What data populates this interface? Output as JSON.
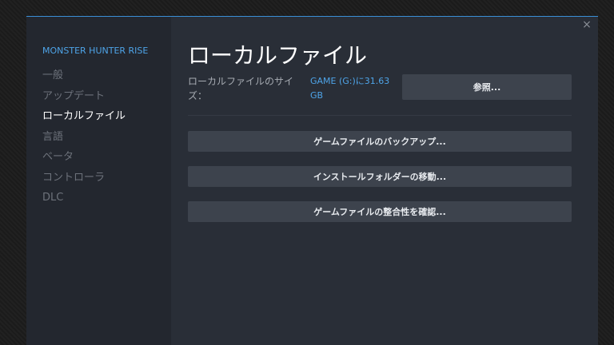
{
  "game_title": "MONSTER HUNTER RISE",
  "close_glyph": "×",
  "nav": [
    {
      "label": "一般",
      "active": false
    },
    {
      "label": "アップデート",
      "active": false
    },
    {
      "label": "ローカルファイル",
      "active": true
    },
    {
      "label": "言語",
      "active": false
    },
    {
      "label": "ベータ",
      "active": false
    },
    {
      "label": "コントローラ",
      "active": false
    },
    {
      "label": "DLC",
      "active": false
    }
  ],
  "main": {
    "title": "ローカルファイル",
    "size_label": "ローカルファイルのサイズ：",
    "size_value": "GAME (G:)に31.63 GB",
    "browse_label": "参照...",
    "backup_label": "ゲームファイルのバックアップ...",
    "move_label": "インストールフォルダーの移動...",
    "verify_label": "ゲームファイルの整合性を確認..."
  },
  "colors": {
    "accent": "#4ea4e8",
    "dialog_bg": "#292e37",
    "sidebar_bg": "#23272f",
    "button_bg": "#3d434d"
  }
}
